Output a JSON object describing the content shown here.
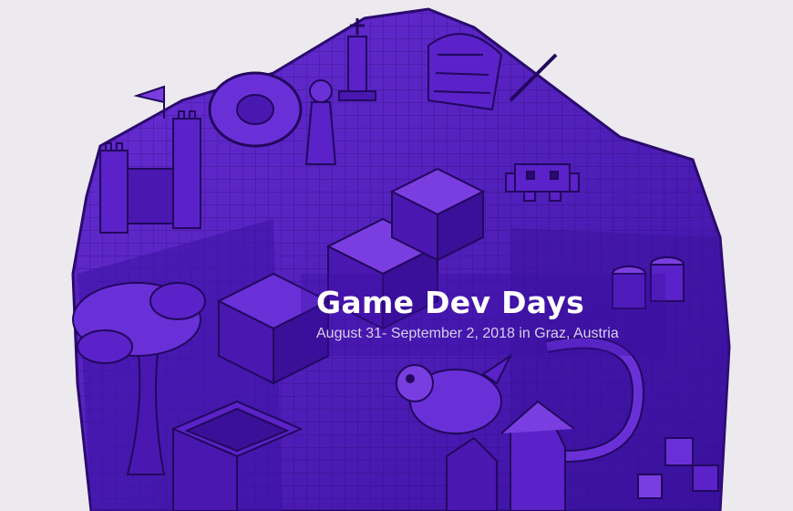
{
  "hero": {
    "title": "Game Dev Days",
    "subtitle": "August 31- September 2, 2018 in Graz, Austria"
  },
  "colors": {
    "page_background": "#eceaee",
    "art_dark": "#2a0a6e",
    "art_mid": "#4b17b8",
    "art_light": "#7a3ee0",
    "title_text": "#ffffff",
    "subtitle_text": "#d9cfee"
  },
  "artwork": {
    "description_icons": [
      "castle-icon",
      "flag-icon",
      "chess-king-icon",
      "chess-pawn-icon",
      "tree-icon",
      "barrel-icon",
      "space-invader-icon",
      "dragon-icon",
      "house-icon"
    ]
  }
}
